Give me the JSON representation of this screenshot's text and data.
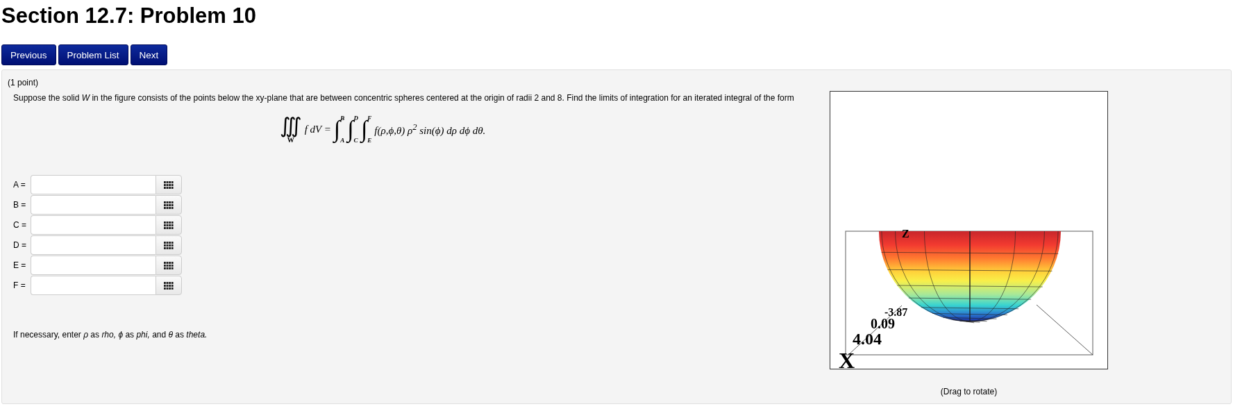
{
  "title": "Section 12.7: Problem 10",
  "nav_buttons": [
    "Previous",
    "Problem List",
    "Next"
  ],
  "problem": {
    "points": "(1 point)",
    "statement": "Suppose the solid *W* in the figure consists of the points below the xy-plane that are between concentric spheres centered at the origin of radii 2 and 8. Find the limits of integration for an iterated integral of the form",
    "formula": {
      "lhs_integral": "∭",
      "lhs_sub": "W",
      "lhs_body": "f dV =",
      "integrals": [
        {
          "sign": "∫",
          "lower": "A",
          "upper": "B"
        },
        {
          "sign": "∫",
          "lower": "C",
          "upper": "D"
        },
        {
          "sign": "∫",
          "lower": "E",
          "upper": "F"
        }
      ],
      "integrand": "f(ρ,ϕ,θ) ρ$^{2}$ sin(ϕ) dρ dϕ dθ."
    },
    "answers": [
      {
        "label": "A ="
      },
      {
        "label": "B ="
      },
      {
        "label": "C ="
      },
      {
        "label": "D ="
      },
      {
        "label": "E ="
      },
      {
        "label": "F ="
      }
    ],
    "hint": "If necessary, enter *ρ* as *rho,* *ϕ* as *phi,* and *θ* as *theta.*"
  },
  "figure": {
    "axis_labels": [
      {
        "kind": "z",
        "text": "Z"
      },
      {
        "kind": "x",
        "text": "X"
      }
    ],
    "tick_labels": [
      "-3.87",
      "0.09",
      "4.04"
    ],
    "caption": "(Drag to rotate)"
  }
}
